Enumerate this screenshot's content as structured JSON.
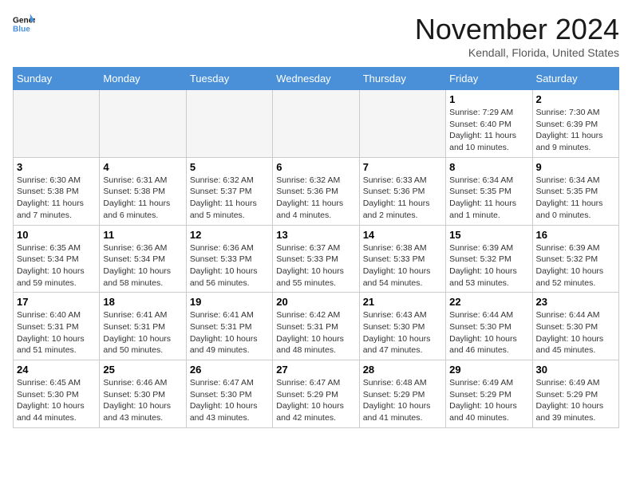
{
  "header": {
    "logo_line1": "General",
    "logo_line2": "Blue",
    "month": "November 2024",
    "location": "Kendall, Florida, United States"
  },
  "days_of_week": [
    "Sunday",
    "Monday",
    "Tuesday",
    "Wednesday",
    "Thursday",
    "Friday",
    "Saturday"
  ],
  "weeks": [
    [
      {
        "day": "",
        "empty": true
      },
      {
        "day": "",
        "empty": true
      },
      {
        "day": "",
        "empty": true
      },
      {
        "day": "",
        "empty": true
      },
      {
        "day": "",
        "empty": true
      },
      {
        "day": "1",
        "sunrise": "7:29 AM",
        "sunset": "6:40 PM",
        "daylight": "11 hours and 10 minutes."
      },
      {
        "day": "2",
        "sunrise": "7:30 AM",
        "sunset": "6:39 PM",
        "daylight": "11 hours and 9 minutes."
      }
    ],
    [
      {
        "day": "3",
        "sunrise": "6:30 AM",
        "sunset": "5:38 PM",
        "daylight": "11 hours and 7 minutes."
      },
      {
        "day": "4",
        "sunrise": "6:31 AM",
        "sunset": "5:38 PM",
        "daylight": "11 hours and 6 minutes."
      },
      {
        "day": "5",
        "sunrise": "6:32 AM",
        "sunset": "5:37 PM",
        "daylight": "11 hours and 5 minutes."
      },
      {
        "day": "6",
        "sunrise": "6:32 AM",
        "sunset": "5:36 PM",
        "daylight": "11 hours and 4 minutes."
      },
      {
        "day": "7",
        "sunrise": "6:33 AM",
        "sunset": "5:36 PM",
        "daylight": "11 hours and 2 minutes."
      },
      {
        "day": "8",
        "sunrise": "6:34 AM",
        "sunset": "5:35 PM",
        "daylight": "11 hours and 1 minute."
      },
      {
        "day": "9",
        "sunrise": "6:34 AM",
        "sunset": "5:35 PM",
        "daylight": "11 hours and 0 minutes."
      }
    ],
    [
      {
        "day": "10",
        "sunrise": "6:35 AM",
        "sunset": "5:34 PM",
        "daylight": "10 hours and 59 minutes."
      },
      {
        "day": "11",
        "sunrise": "6:36 AM",
        "sunset": "5:34 PM",
        "daylight": "10 hours and 58 minutes."
      },
      {
        "day": "12",
        "sunrise": "6:36 AM",
        "sunset": "5:33 PM",
        "daylight": "10 hours and 56 minutes."
      },
      {
        "day": "13",
        "sunrise": "6:37 AM",
        "sunset": "5:33 PM",
        "daylight": "10 hours and 55 minutes."
      },
      {
        "day": "14",
        "sunrise": "6:38 AM",
        "sunset": "5:33 PM",
        "daylight": "10 hours and 54 minutes."
      },
      {
        "day": "15",
        "sunrise": "6:39 AM",
        "sunset": "5:32 PM",
        "daylight": "10 hours and 53 minutes."
      },
      {
        "day": "16",
        "sunrise": "6:39 AM",
        "sunset": "5:32 PM",
        "daylight": "10 hours and 52 minutes."
      }
    ],
    [
      {
        "day": "17",
        "sunrise": "6:40 AM",
        "sunset": "5:31 PM",
        "daylight": "10 hours and 51 minutes."
      },
      {
        "day": "18",
        "sunrise": "6:41 AM",
        "sunset": "5:31 PM",
        "daylight": "10 hours and 50 minutes."
      },
      {
        "day": "19",
        "sunrise": "6:41 AM",
        "sunset": "5:31 PM",
        "daylight": "10 hours and 49 minutes."
      },
      {
        "day": "20",
        "sunrise": "6:42 AM",
        "sunset": "5:31 PM",
        "daylight": "10 hours and 48 minutes."
      },
      {
        "day": "21",
        "sunrise": "6:43 AM",
        "sunset": "5:30 PM",
        "daylight": "10 hours and 47 minutes."
      },
      {
        "day": "22",
        "sunrise": "6:44 AM",
        "sunset": "5:30 PM",
        "daylight": "10 hours and 46 minutes."
      },
      {
        "day": "23",
        "sunrise": "6:44 AM",
        "sunset": "5:30 PM",
        "daylight": "10 hours and 45 minutes."
      }
    ],
    [
      {
        "day": "24",
        "sunrise": "6:45 AM",
        "sunset": "5:30 PM",
        "daylight": "10 hours and 44 minutes."
      },
      {
        "day": "25",
        "sunrise": "6:46 AM",
        "sunset": "5:30 PM",
        "daylight": "10 hours and 43 minutes."
      },
      {
        "day": "26",
        "sunrise": "6:47 AM",
        "sunset": "5:30 PM",
        "daylight": "10 hours and 43 minutes."
      },
      {
        "day": "27",
        "sunrise": "6:47 AM",
        "sunset": "5:29 PM",
        "daylight": "10 hours and 42 minutes."
      },
      {
        "day": "28",
        "sunrise": "6:48 AM",
        "sunset": "5:29 PM",
        "daylight": "10 hours and 41 minutes."
      },
      {
        "day": "29",
        "sunrise": "6:49 AM",
        "sunset": "5:29 PM",
        "daylight": "10 hours and 40 minutes."
      },
      {
        "day": "30",
        "sunrise": "6:49 AM",
        "sunset": "5:29 PM",
        "daylight": "10 hours and 39 minutes."
      }
    ]
  ]
}
